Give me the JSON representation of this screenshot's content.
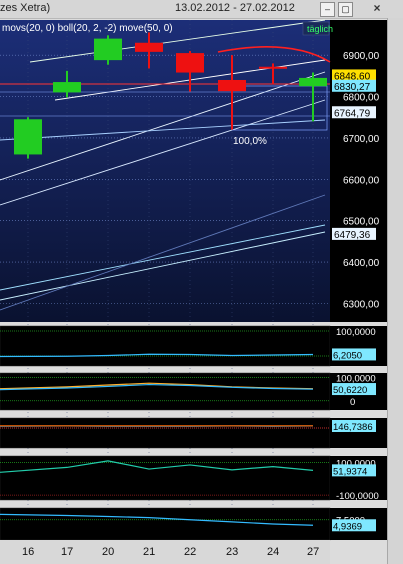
{
  "window": {
    "title_partial": "zes Xetra)",
    "date_range": "13.02.2012 - 27.02.2012",
    "period_button": "täglich",
    "close_label": "×"
  },
  "colors": {
    "up_candle": "#22cc22",
    "down_candle": "#ee1111",
    "price_panel_top": "#1c2e78",
    "price_panel_bottom": "#0a1230",
    "indicator_bg": "#000000",
    "axis_bg": "#000000",
    "axis_text": "#ffffff"
  },
  "chart_data": {
    "type": "candlestick",
    "indicator_legend": "movs(20, 0)  boll(20, 2, -2)  move(50, 0)",
    "x_axis": {
      "days": [
        "16",
        "17",
        "20",
        "21",
        "22",
        "23",
        "24",
        "27"
      ]
    },
    "price_axis": {
      "ticks": [
        "6900,00",
        "6800,00",
        "6700,00",
        "6600,00",
        "6500,00",
        "6400,00",
        "6300,00"
      ],
      "range": [
        6255,
        6985
      ]
    },
    "candles": [
      {
        "day": "16",
        "open": 6660,
        "close": 6745,
        "high": 6750,
        "low": 6650,
        "color": "up"
      },
      {
        "day": "17",
        "open": 6810,
        "close": 6835,
        "high": 6862,
        "low": 6798,
        "color": "up"
      },
      {
        "day": "20",
        "open": 6888,
        "close": 6940,
        "high": 6948,
        "low": 6877,
        "color": "up"
      },
      {
        "day": "21",
        "open": 6930,
        "close": 6908,
        "high": 6955,
        "low": 6868,
        "color": "down"
      },
      {
        "day": "22",
        "open": 6905,
        "close": 6858,
        "high": 6910,
        "low": 6812,
        "color": "down"
      },
      {
        "day": "23",
        "open": 6840,
        "close": 6813,
        "high": 6900,
        "low": 6720,
        "color": "down"
      },
      {
        "day": "24",
        "open": 6872,
        "close": 6868,
        "high": 6880,
        "low": 6830,
        "color": "down"
      },
      {
        "day": "27",
        "open": 6825,
        "close": 6845,
        "high": 6858,
        "low": 6740,
        "color": "up"
      }
    ],
    "price_markers": [
      {
        "label": "6848,60",
        "value": 6851,
        "style": "yellow"
      },
      {
        "label": "6830,27",
        "value": 6826,
        "style": "cyan"
      },
      {
        "label": "6764,79",
        "value": 6762,
        "style": "white"
      },
      {
        "label": "6479,36",
        "value": 6468,
        "style": "white"
      }
    ],
    "annotation": "100,0%",
    "indicator_panels": [
      {
        "name": "panel-1",
        "ticks": [
          {
            "label": "100,0000",
            "value": 100
          },
          {
            "label": "0",
            "value": 0
          }
        ],
        "range": [
          -40,
          120
        ],
        "current": {
          "label": "6,2050",
          "value": 6.2
        },
        "series": [
          {
            "color": "#33bbff",
            "values": [
              -2,
              -1,
              2,
              7,
              6,
              2,
              4,
              6
            ]
          }
        ]
      },
      {
        "name": "panel-2",
        "ticks": [
          {
            "label": "100,0000",
            "value": 100
          },
          {
            "label": "0",
            "value": 0
          }
        ],
        "range": [
          -40,
          120
        ],
        "current": {
          "label": "50,6220",
          "value": 50.6
        },
        "series": [
          {
            "color": "#ffb030",
            "values": [
              52,
              60,
              68,
              76,
              70,
              60,
              55,
              52
            ]
          },
          {
            "color": "#33bbff",
            "values": [
              48,
              55,
              62,
              70,
              66,
              58,
              53,
              50
            ]
          }
        ]
      },
      {
        "name": "panel-3",
        "ticks": [],
        "range": [
          0,
          200
        ],
        "current": {
          "label": "146,7386",
          "value": 146.7
        },
        "series": [
          {
            "color": "#33bbff",
            "values": [
              146,
              147,
              146,
              146,
              146,
              147,
              146,
              147
            ]
          },
          {
            "color": "#ff6600",
            "values": [
              148,
              148,
              148,
              148,
              148,
              148,
              148,
              148
            ]
          }
        ]
      },
      {
        "name": "panel-4",
        "ticks": [
          {
            "label": "100,0000",
            "value": 100
          },
          {
            "label": "-100,0000",
            "value": -100
          }
        ],
        "range": [
          -130,
          140
        ],
        "current": {
          "label": "51,9374",
          "value": 51.9
        },
        "series": [
          {
            "color": "#22ccaa",
            "values": [
              40,
              70,
              110,
              60,
              85,
              55,
              75,
              52
            ]
          }
        ]
      },
      {
        "name": "panel-5",
        "ticks": [
          {
            "label": "7,5000",
            "value": 7.5
          }
        ],
        "range": [
          -2,
          13
        ],
        "current": {
          "label": "4,9369",
          "value": 4.9
        },
        "series": [
          {
            "color": "#33bbff",
            "values": [
              10,
              9.5,
              9,
              8.5,
              7.5,
              6.5,
              5.5,
              4.9
            ]
          }
        ]
      }
    ]
  }
}
